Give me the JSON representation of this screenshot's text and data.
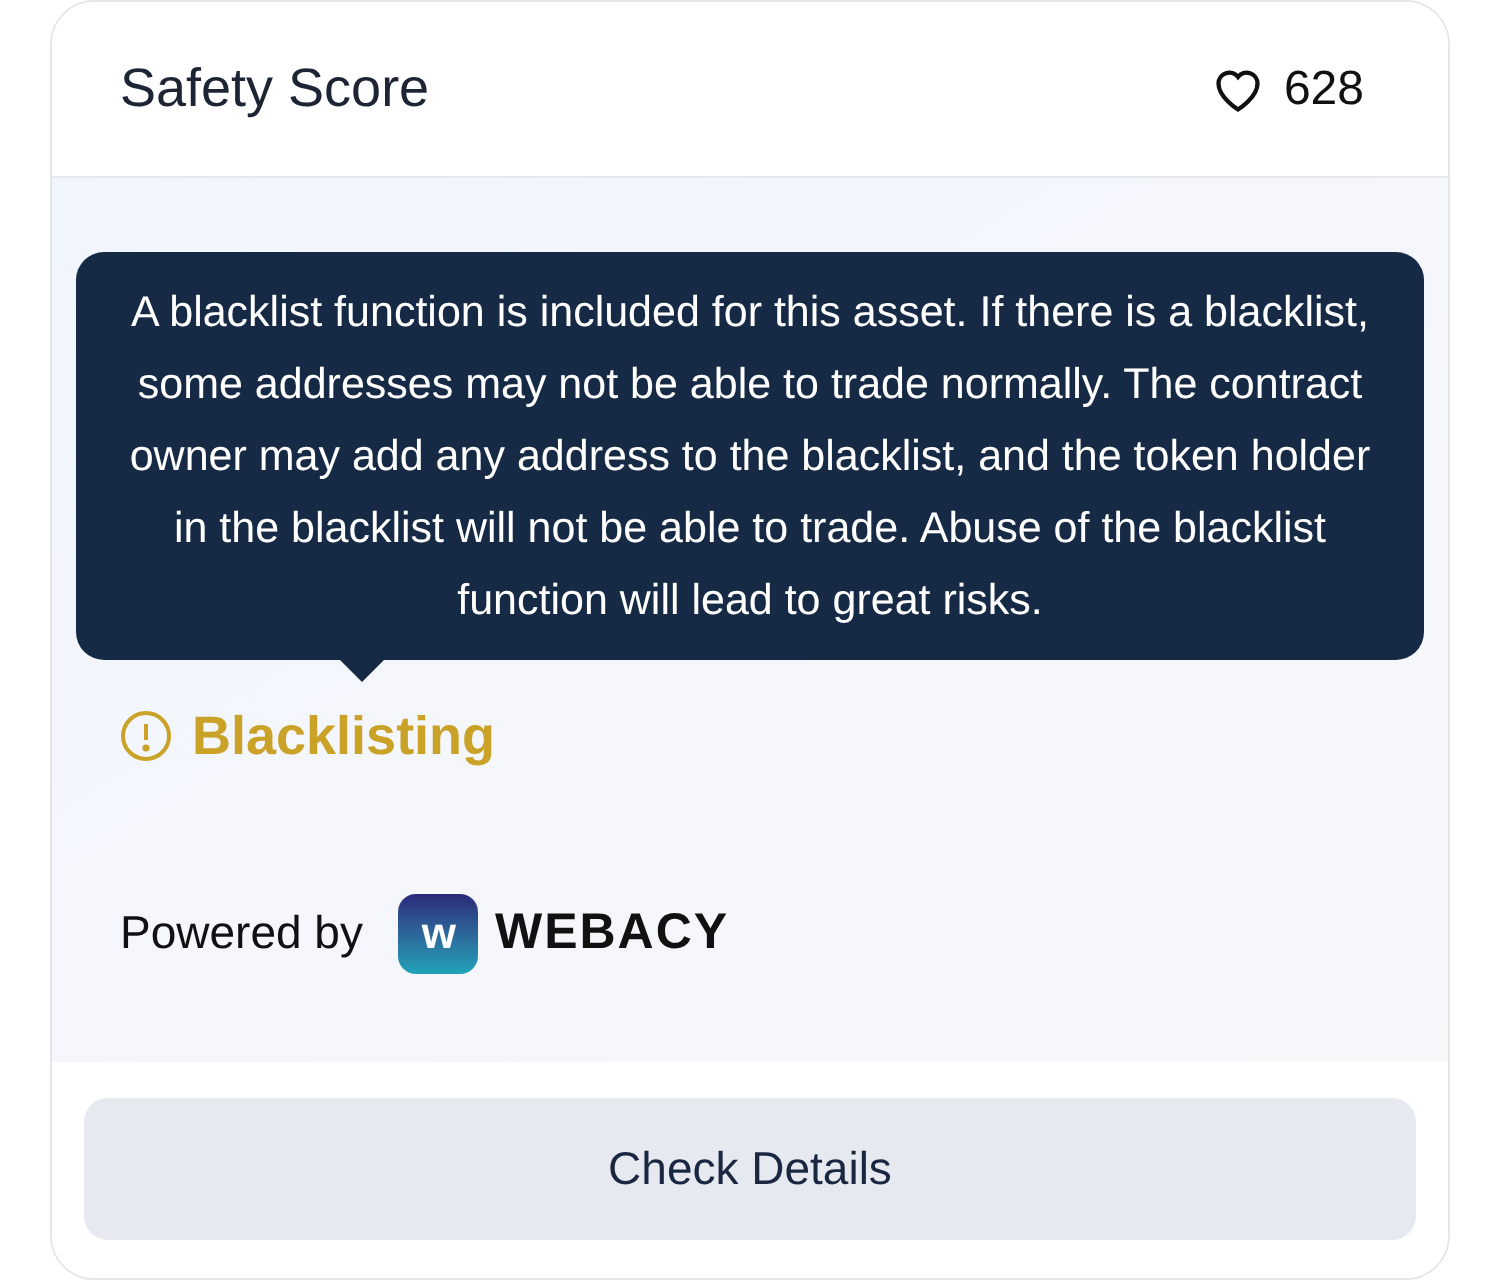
{
  "header": {
    "title": "Safety Score",
    "likes": "628"
  },
  "tooltip": {
    "text": "A blacklist function is included for this asset. If there is a blacklist, some addresses may not be able to trade normally. The contract owner may add any address to the blacklist, and the token holder in the blacklist will not be able to trade. Abuse of the blacklist function will lead to great risks."
  },
  "risk_item": {
    "label": "Blacklisting"
  },
  "powered_by": {
    "label": "Powered by",
    "logo_mark": "w",
    "brand": "WEBACY"
  },
  "button": {
    "label": "Check Details"
  }
}
